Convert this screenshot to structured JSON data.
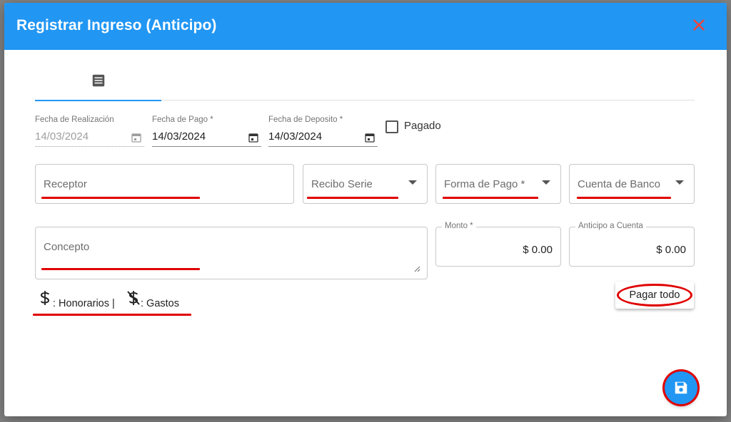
{
  "dialog": {
    "title": "Registrar Ingreso (Anticipo)"
  },
  "tabs": [
    {
      "icon": "list-icon",
      "active": true
    }
  ],
  "dates": {
    "realizacion": {
      "label": "Fecha de Realización",
      "value": "14/03/2024",
      "disabled": true
    },
    "pago": {
      "label": "Fecha de Pago *",
      "value": "14/03/2024"
    },
    "deposito": {
      "label": "Fecha de Deposito *",
      "value": "14/03/2024"
    }
  },
  "pagado": {
    "label": "Pagado",
    "checked": false
  },
  "fields": {
    "receptor": "Receptor",
    "recibo_serie": "Recibo Serie",
    "forma_pago": "Forma de Pago *",
    "cuenta_banco": "Cuenta de Banco",
    "concepto": "Concepto"
  },
  "amounts": {
    "monto": {
      "label": "Monto *",
      "value": "$ 0.00"
    },
    "anticipo": {
      "label": "Anticipo a Cuenta",
      "value": "$ 0.00"
    }
  },
  "legend": {
    "honorarios": ": Honorarios |",
    "gastos": ": Gastos"
  },
  "buttons": {
    "pagar_todo": "Pagar todo"
  },
  "colors": {
    "primary": "#2196f3",
    "annotation_red": "#e00000",
    "close_icon": "#f44336"
  }
}
